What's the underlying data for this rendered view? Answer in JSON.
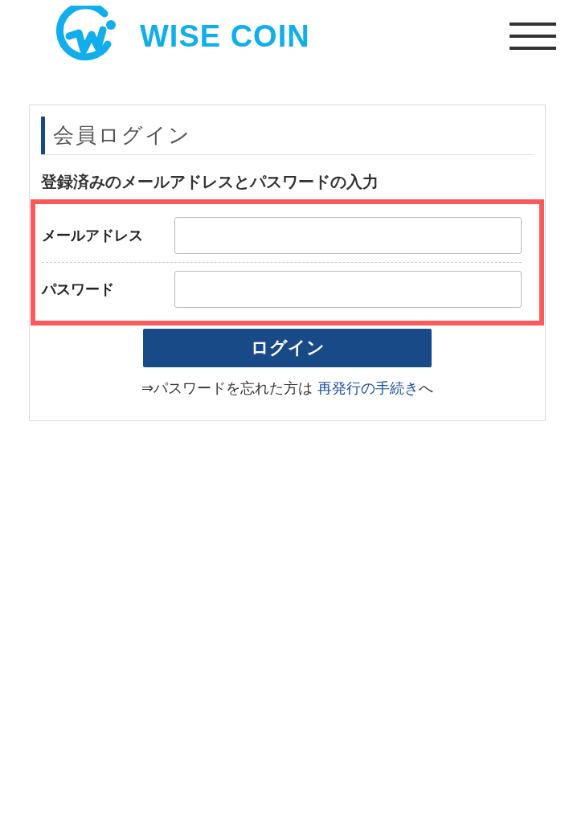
{
  "header": {
    "brand": "WISE COIN"
  },
  "login": {
    "title": "会員ログイン",
    "subtitle": "登録済みのメールアドレスとパスワードの入力",
    "highlighted": true,
    "fields": [
      {
        "label": "メールアドレス"
      },
      {
        "label": "パスワード"
      }
    ],
    "submit": "ログイン",
    "forgot": {
      "before": "⇒パスワードを忘れた方は ",
      "link": "再発行の手続き",
      "after": "へ"
    }
  }
}
